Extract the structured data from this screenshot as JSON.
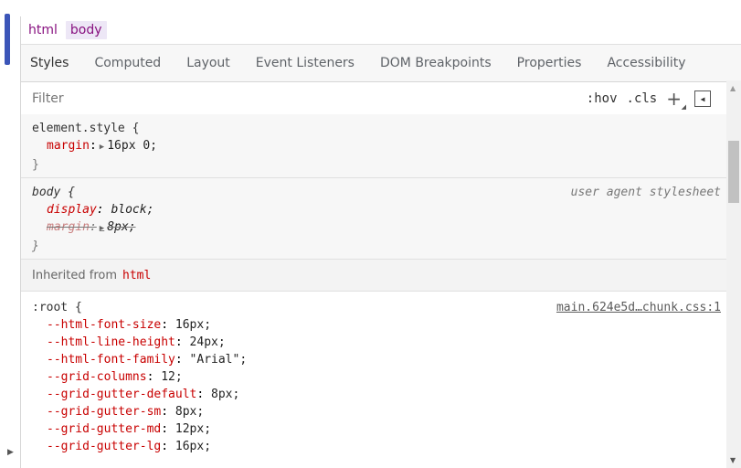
{
  "breadcrumb": [
    "html",
    "body"
  ],
  "tabs": [
    "Styles",
    "Computed",
    "Layout",
    "Event Listeners",
    "DOM Breakpoints",
    "Properties",
    "Accessibility"
  ],
  "filter": {
    "placeholder": "Filter",
    "hov": ":hov",
    "cls": ".cls",
    "plus": "+"
  },
  "element_style": {
    "selector": "element.style {",
    "decl": {
      "prop": "margin",
      "value": "16px 0;"
    },
    "close": "}"
  },
  "body_rule": {
    "selector": "body {",
    "origin": "user agent stylesheet",
    "decls": [
      {
        "prop": "display",
        "value": "block;"
      },
      {
        "prop": "margin",
        "value": "8px;"
      }
    ],
    "close": "}"
  },
  "inherited": {
    "label": "Inherited from",
    "tag": "html"
  },
  "root_rule": {
    "selector": ":root {",
    "origin": "main.624e5d…chunk.css:1",
    "decls": [
      {
        "prop": "--html-font-size",
        "value": "16px;"
      },
      {
        "prop": "--html-line-height",
        "value": "24px;"
      },
      {
        "prop": "--html-font-family",
        "value": "\"Arial\";"
      },
      {
        "prop": "--grid-columns",
        "value": "12;"
      },
      {
        "prop": "--grid-gutter-default",
        "value": "8px;"
      },
      {
        "prop": "--grid-gutter-sm",
        "value": "8px;"
      },
      {
        "prop": "--grid-gutter-md",
        "value": "12px;"
      },
      {
        "prop": "--grid-gutter-lg",
        "value": "16px;"
      }
    ]
  },
  "colors": {
    "accent": "#3b55b8",
    "property": "#c80000",
    "tag": "#881280"
  }
}
